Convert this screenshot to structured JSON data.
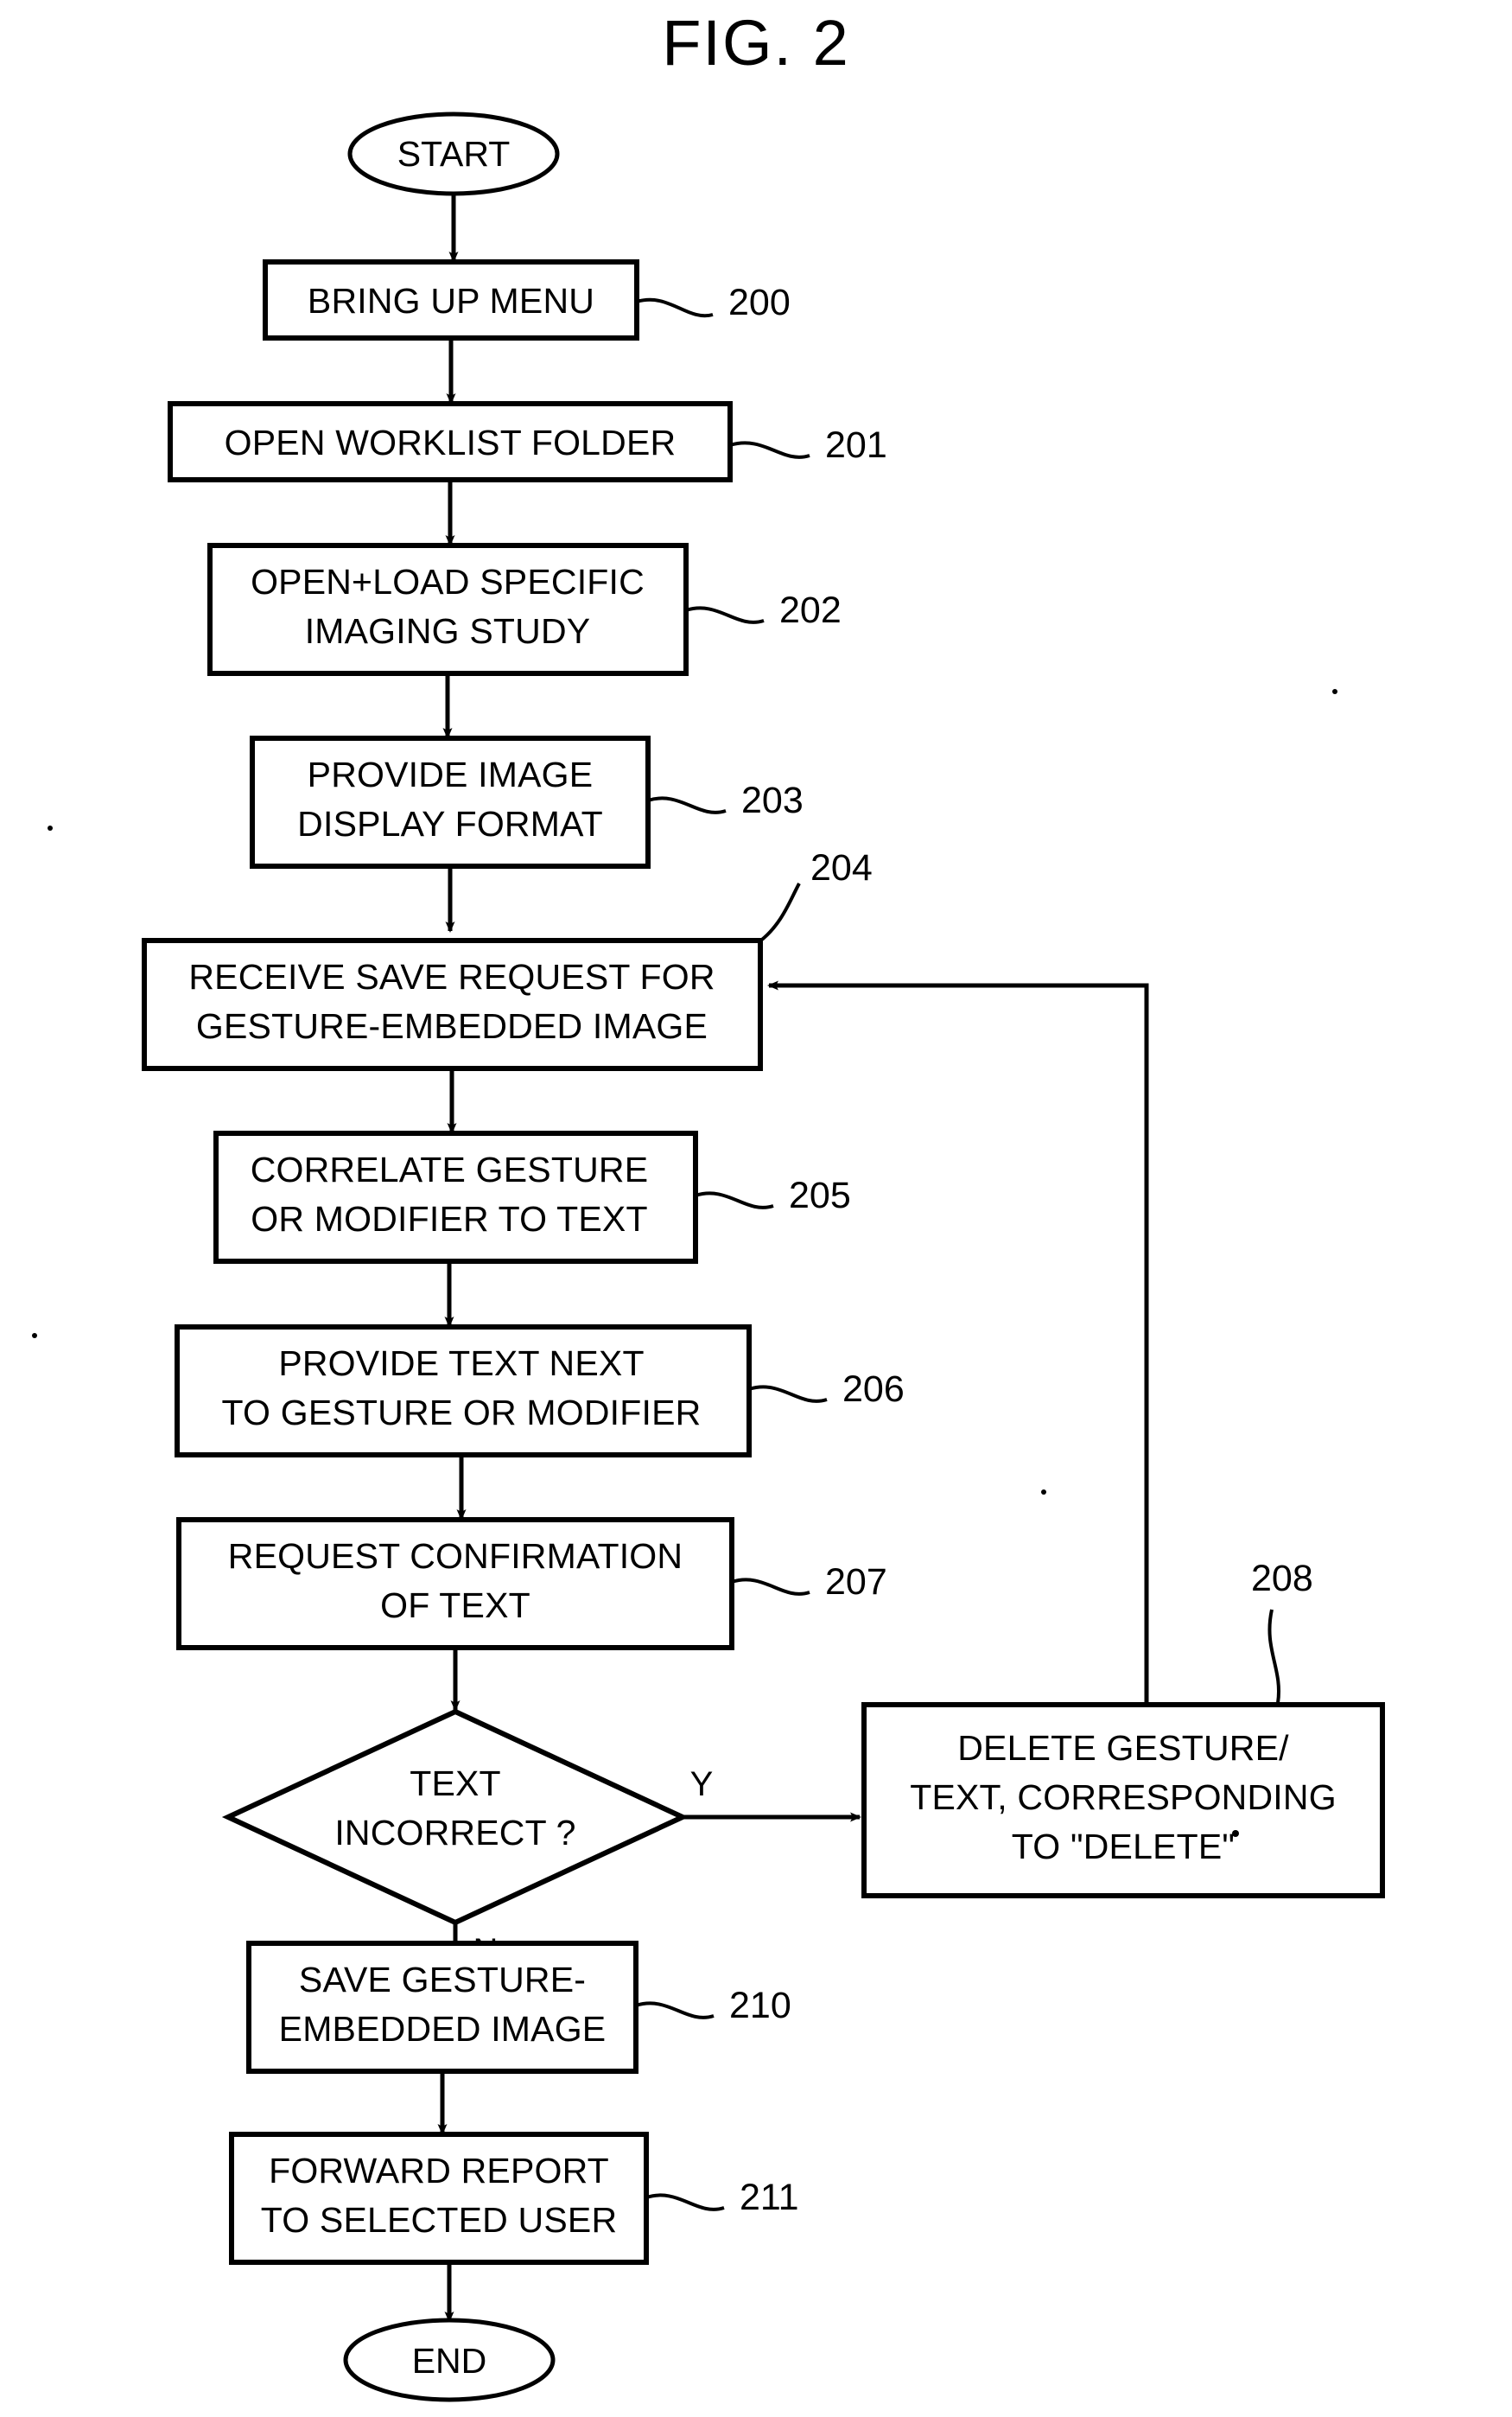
{
  "figure": {
    "title": "FIG. 2",
    "type": "patent-flowchart"
  },
  "terminators": {
    "start": "START",
    "end": "END"
  },
  "branches": {
    "yes": "Y",
    "no": "N"
  },
  "decision": {
    "line1": "TEXT",
    "line2": "INCORRECT ?",
    "ref": ""
  },
  "steps": [
    {
      "ref": "200",
      "line1": "BRING UP MENU",
      "line2": "",
      "line3": ""
    },
    {
      "ref": "201",
      "line1": "OPEN WORKLIST FOLDER",
      "line2": "",
      "line3": ""
    },
    {
      "ref": "202",
      "line1": "OPEN+LOAD SPECIFIC",
      "line2": "IMAGING STUDY",
      "line3": ""
    },
    {
      "ref": "203",
      "line1": "PROVIDE IMAGE",
      "line2": "DISPLAY FORMAT",
      "line3": ""
    },
    {
      "ref": "204",
      "line1": "RECEIVE SAVE REQUEST FOR",
      "line2": "GESTURE-EMBEDDED IMAGE",
      "line3": ""
    },
    {
      "ref": "205",
      "line1": "CORRELATE GESTURE",
      "line2": "OR MODIFIER TO TEXT",
      "line3": ""
    },
    {
      "ref": "206",
      "line1": "PROVIDE TEXT NEXT",
      "line2": "TO GESTURE OR MODIFIER",
      "line3": ""
    },
    {
      "ref": "207",
      "line1": "REQUEST CONFIRMATION",
      "line2": "OF TEXT",
      "line3": ""
    },
    {
      "ref": "208",
      "line1": "DELETE GESTURE/",
      "line2": "TEXT, CORRESPONDING",
      "line3": "TO \"DELETE\""
    },
    {
      "ref": "210",
      "line1": "SAVE GESTURE-",
      "line2": "EMBEDDED IMAGE",
      "line3": ""
    },
    {
      "ref": "211",
      "line1": "FORWARD REPORT",
      "line2": "TO SELECTED USER",
      "line3": ""
    }
  ],
  "colors": {
    "ink": "#000000",
    "paper": "#ffffff"
  }
}
